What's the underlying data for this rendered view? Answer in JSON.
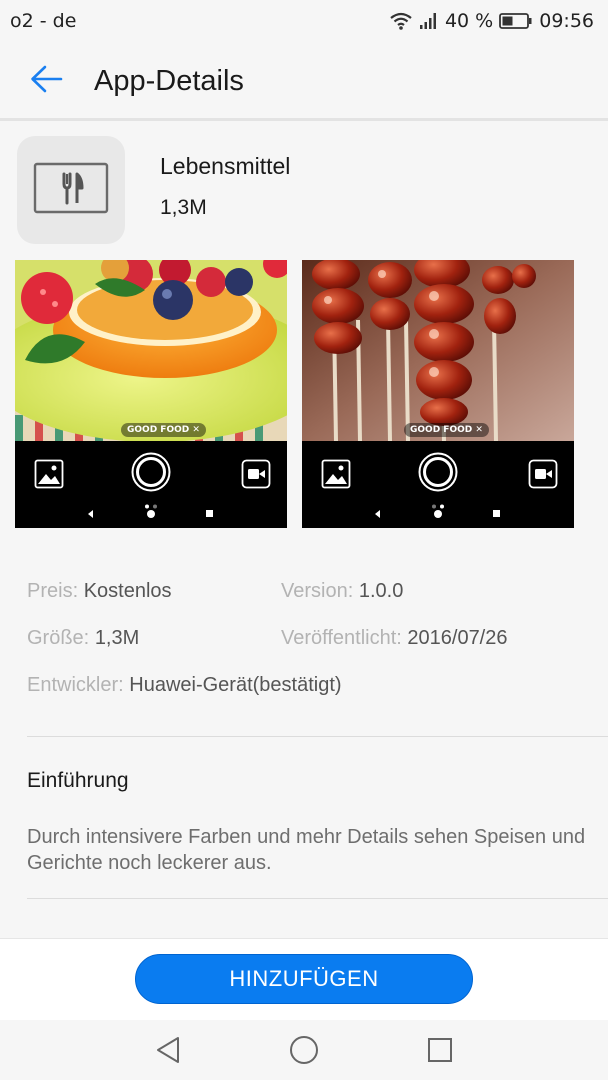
{
  "status_bar": {
    "carrier": "o2 - de",
    "battery_percent": "40 %",
    "time": "09:56",
    "icons": [
      "wifi-icon",
      "signal-icon",
      "battery-icon"
    ]
  },
  "app_bar": {
    "title": "App-Details",
    "back_icon": "arrow-left-icon",
    "accent_color": "#1a7ff0"
  },
  "app": {
    "name": "Lebensmittel",
    "size": "1,3M",
    "icon": "fork-knife-icon"
  },
  "screenshots": [
    {
      "watermark": "GOOD FOOD ✕"
    },
    {
      "watermark": "GOOD FOOD ✕"
    }
  ],
  "details": {
    "price_label": "Preis:",
    "price_value": "Kostenlos",
    "version_label": "Version:",
    "version_value": "1.0.0",
    "size_label": "Größe:",
    "size_value": "1,3M",
    "published_label": "Veröffentlicht:",
    "published_value": "2016/07/26",
    "developer_label": "Entwickler:",
    "developer_value": "Huawei-Gerät(bestätigt)"
  },
  "intro": {
    "title": "Einführung",
    "text": "Durch intensivere Farben und mehr Details sehen Speisen und Gerichte noch leckerer aus."
  },
  "action": {
    "add_label": "HINZUFÜGEN",
    "button_color": "#0a7cf0"
  },
  "nav_bar": {
    "icons": [
      "nav-back-icon",
      "nav-home-icon",
      "nav-recents-icon"
    ]
  }
}
